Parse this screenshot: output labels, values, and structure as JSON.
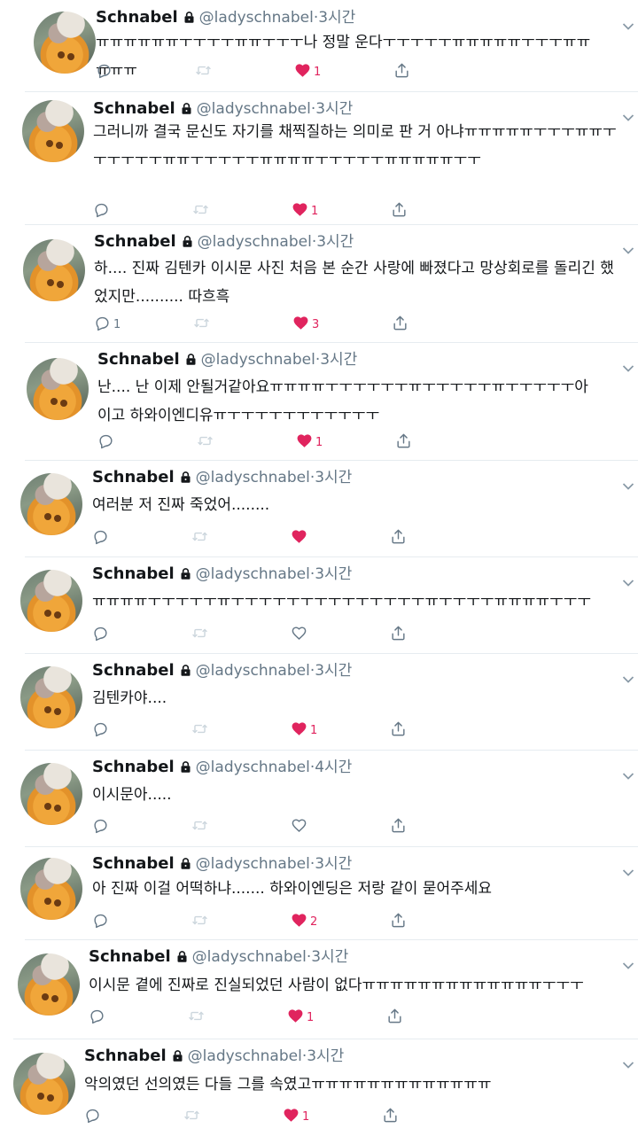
{
  "tweets": [
    {
      "name": "Schnabel",
      "handle": "@ladyschnabel",
      "time": "3시간",
      "text": "ㅠㅠㅠㅠㅠㅠㅜㅜㅜㅜㅠㅠㅜㅜㅜ나 정말 운다ㅜㅜㅜㅜㅜㅠㅠㅠㅠㅠㅜㅜㅜㅠㅠㅠㅠㅠ",
      "replies": "",
      "liked": true,
      "likes": "1"
    },
    {
      "name": "Schnabel",
      "handle": "@ladyschnabel",
      "time": "3시간",
      "text": "그러니까 결국 문신도 자기를 채찍질하는 의미로 판 거 아냐ㅠㅠㅠㅠㅠㅜㅜㅜㅠㅠㅜㅜㅜㅜㅜㅜㅠㅠㅜㅜㅜㅜㅜㅠㅠㅠㅠㅜㅜㅜㅜㅜㅠㅠㅠㅠㅠㅜㅜ",
      "replies": "",
      "liked": true,
      "likes": "1"
    },
    {
      "name": "Schnabel",
      "handle": "@ladyschnabel",
      "time": "3시간",
      "text": "하.... 진짜 김텐카 이시문 사진 처음 본 순간 사랑에 빠졌다고 망상회로를 돌리긴 했었지만.......... 따흐흑",
      "replies": "1",
      "liked": true,
      "likes": "3"
    },
    {
      "name": "Schnabel",
      "handle": "@ladyschnabel",
      "time": "3시간",
      "text": "난.... 난 이제 안될거같아요ㅠㅠㅠㅠㅜㅜㅜㅜㅜㅜㅠㅜㅜㅜㅜㅜㅠㅜㅜㅜㅜㅜ아이고 하와이엔디유ㅠㅜㅜㅜㅜㅜㅜㅜㅜㅜㅜㅜ",
      "replies": "",
      "liked": true,
      "likes": "1"
    },
    {
      "name": "Schnabel",
      "handle": "@ladyschnabel",
      "time": "3시간",
      "text": "여러분 저 진짜 죽었어........",
      "replies": "",
      "liked": true,
      "likes": ""
    },
    {
      "name": "Schnabel",
      "handle": "@ladyschnabel",
      "time": "3시간",
      "text": "ㅠㅠㅠㅠㅜㅜㅜㅜㅜㅠㅜㅜㅜㅜㅜㅜㅜㅜㅜㅜㅜㅜㅜㅜㅠㅜㅜㅜㅜㅠㅠㅠㅠㅜㅜㅜ",
      "replies": "",
      "liked": false,
      "likes": ""
    },
    {
      "name": "Schnabel",
      "handle": "@ladyschnabel",
      "time": "3시간",
      "text": "김텐카야....",
      "replies": "",
      "liked": true,
      "likes": "1"
    },
    {
      "name": "Schnabel",
      "handle": "@ladyschnabel",
      "time": "4시간",
      "text": "이시문아.....",
      "replies": "",
      "liked": false,
      "likes": ""
    },
    {
      "name": "Schnabel",
      "handle": "@ladyschnabel",
      "time": "3시간",
      "text": "아 진짜 이걸 어떡하냐....... 하와이엔딩은 저랑 같이 묻어주세요",
      "replies": "",
      "liked": true,
      "likes": "2"
    },
    {
      "name": "Schnabel",
      "handle": "@ladyschnabel",
      "time": "3시간",
      "text": "이시문 곁에 진짜로 진실되었던 사람이 없다ㅠㅠㅠㅠㅠㅠㅠㅠㅠㅠㅠㅠㅠㅜㅜㅜ",
      "replies": "",
      "liked": true,
      "likes": "1"
    },
    {
      "name": "Schnabel",
      "handle": "@ladyschnabel",
      "time": "3시간",
      "text": "악의였던 선의였든 다들 그를 속였고ㅠㅠㅠㅠㅠㅠㅠㅠㅠㅠㅠㅠㅠ",
      "replies": "",
      "liked": true,
      "likes": "1"
    }
  ],
  "separator": "·",
  "colors": {
    "like": "#e0245e",
    "muted": "#657786",
    "icon": "#657786",
    "retweet_disabled": "#ccd6dd"
  },
  "icons": {
    "reply": "reply-icon",
    "retweet": "retweet-icon",
    "like": "heart-icon",
    "share": "share-icon",
    "lock": "lock-icon",
    "menu": "chevron-down-icon"
  }
}
